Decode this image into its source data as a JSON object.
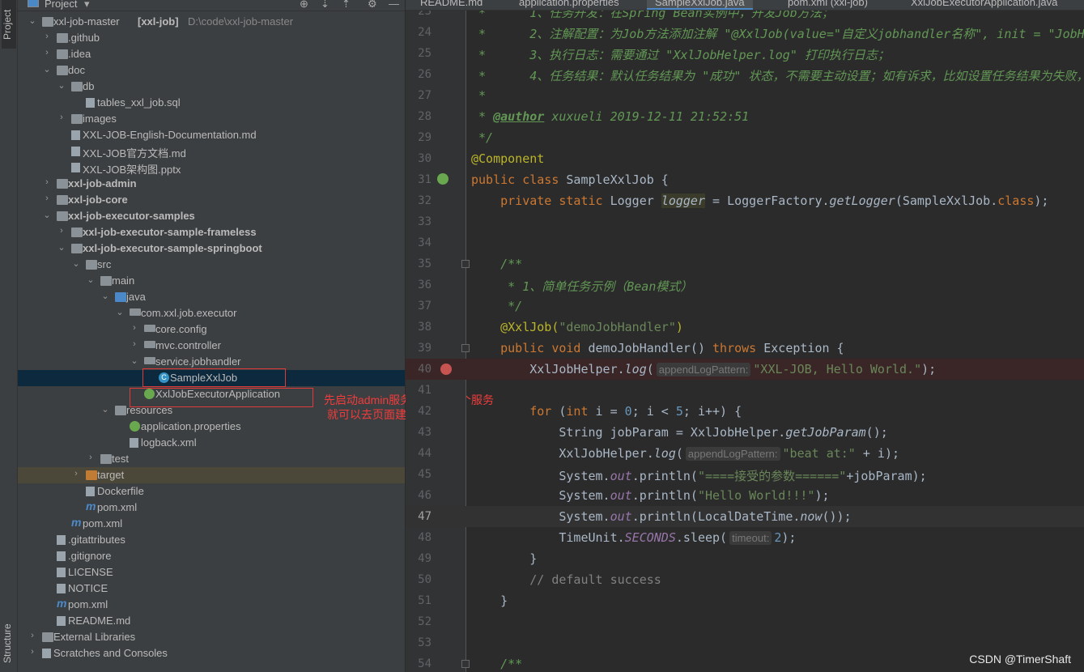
{
  "sidebar": {
    "project_tab": "Project",
    "structure_tab": "Structure"
  },
  "project_panel": {
    "title": "Project",
    "header_icons": [
      "locate-icon",
      "expand-all-icon",
      "collapse-all-icon",
      "gear-icon",
      "minimize-icon"
    ],
    "tree": [
      {
        "label": "xxl-job-master",
        "suffix": "[xxl-job]",
        "hint": "D:\\code\\xxl-job-master",
        "depth": 0,
        "arrow": "open",
        "icon": "module"
      },
      {
        "label": ".github",
        "depth": 1,
        "arrow": "closed",
        "icon": "folder"
      },
      {
        "label": ".idea",
        "depth": 1,
        "arrow": "closed",
        "icon": "folder"
      },
      {
        "label": "doc",
        "depth": 1,
        "arrow": "open",
        "icon": "folder"
      },
      {
        "label": "db",
        "depth": 2,
        "arrow": "open",
        "icon": "folder"
      },
      {
        "label": "tables_xxl_job.sql",
        "depth": 3,
        "icon": "sql"
      },
      {
        "label": "images",
        "depth": 2,
        "arrow": "closed",
        "icon": "folder"
      },
      {
        "label": "XXL-JOB-English-Documentation.md",
        "depth": 2,
        "icon": "md"
      },
      {
        "label": "XXL-JOB官方文档.md",
        "depth": 2,
        "icon": "md"
      },
      {
        "label": "XXL-JOB架构图.pptx",
        "depth": 2,
        "icon": "file"
      },
      {
        "label": "xxl-job-admin",
        "depth": 1,
        "arrow": "closed",
        "icon": "folder",
        "bold": true
      },
      {
        "label": "xxl-job-core",
        "depth": 1,
        "arrow": "closed",
        "icon": "folder",
        "bold": true
      },
      {
        "label": "xxl-job-executor-samples",
        "depth": 1,
        "arrow": "open",
        "icon": "folder",
        "bold": true
      },
      {
        "label": "xxl-job-executor-sample-frameless",
        "depth": 2,
        "arrow": "closed",
        "icon": "folder",
        "bold": true
      },
      {
        "label": "xxl-job-executor-sample-springboot",
        "depth": 2,
        "arrow": "open",
        "icon": "folder",
        "bold": true
      },
      {
        "label": "src",
        "depth": 3,
        "arrow": "open",
        "icon": "folder"
      },
      {
        "label": "main",
        "depth": 4,
        "arrow": "open",
        "icon": "folder"
      },
      {
        "label": "java",
        "depth": 5,
        "arrow": "open",
        "icon": "folder-blue"
      },
      {
        "label": "com.xxl.job.executor",
        "depth": 6,
        "arrow": "open",
        "icon": "package"
      },
      {
        "label": "core.config",
        "depth": 7,
        "arrow": "closed",
        "icon": "package"
      },
      {
        "label": "mvc.controller",
        "depth": 7,
        "arrow": "closed",
        "icon": "package"
      },
      {
        "label": "service.jobhandler",
        "depth": 7,
        "arrow": "open",
        "icon": "package"
      },
      {
        "label": "SampleXxlJob",
        "depth": 8,
        "icon": "class",
        "selected": true
      },
      {
        "label": "XxlJobExecutorApplication",
        "depth": 7,
        "icon": "spring-class"
      },
      {
        "label": "resources",
        "depth": 5,
        "arrow": "open",
        "icon": "folder"
      },
      {
        "label": "application.properties",
        "depth": 6,
        "icon": "spring-props"
      },
      {
        "label": "logback.xml",
        "depth": 6,
        "icon": "xml"
      },
      {
        "label": "test",
        "depth": 4,
        "arrow": "closed",
        "icon": "folder"
      },
      {
        "label": "target",
        "depth": 3,
        "arrow": "closed",
        "icon": "folder-orange",
        "highlight": true
      },
      {
        "label": "Dockerfile",
        "depth": 3,
        "icon": "file"
      },
      {
        "label": "pom.xml",
        "depth": 3,
        "icon": "maven"
      },
      {
        "label": "pom.xml",
        "depth": 2,
        "icon": "maven"
      },
      {
        "label": ".gitattributes",
        "depth": 1,
        "icon": "file"
      },
      {
        "label": ".gitignore",
        "depth": 1,
        "icon": "file"
      },
      {
        "label": "LICENSE",
        "depth": 1,
        "icon": "file"
      },
      {
        "label": "NOTICE",
        "depth": 1,
        "icon": "file"
      },
      {
        "label": "pom.xml",
        "depth": 1,
        "icon": "maven"
      },
      {
        "label": "README.md",
        "depth": 1,
        "icon": "md"
      },
      {
        "label": "External Libraries",
        "depth": 0,
        "arrow": "closed",
        "icon": "library"
      },
      {
        "label": "Scratches and Consoles",
        "depth": 0,
        "arrow": "closed",
        "icon": "scratch"
      }
    ]
  },
  "annotation": {
    "line1": "先启动admin服务 再启动这个服务",
    "line2": "就可以去页面建定时任务了",
    "color": "#f03c3c"
  },
  "tabs": [
    {
      "label": "README.md",
      "icon": "md"
    },
    {
      "label": "application.properties",
      "icon": "spring-props"
    },
    {
      "label": "SampleXxlJob.java",
      "icon": "class",
      "active": true
    },
    {
      "label": "pom.xml (xxl-job)",
      "icon": "maven"
    },
    {
      "label": "XxlJobExecutorApplication.java",
      "icon": "spring-class"
    }
  ],
  "editor": {
    "first_line": 23,
    "breakpoint_line": 40,
    "current_line": 47,
    "lines": [
      [
        [
          " *      1、任务开发：在Spring Bean实例中，开发Job方法；",
          "c"
        ]
      ],
      [
        [
          " *      2、注解配置：为Job方法添加注解 \"@XxlJob(value=\"自定义jobhandler名称\", init = \"JobH",
          "c"
        ]
      ],
      [
        [
          " *      3、执行日志：需要通过 \"XxlJobHelper.log\" 打印执行日志；",
          "c"
        ]
      ],
      [
        [
          " *      4、任务结果：默认任务结果为 \"成功\" 状态，不需要主动设置；如有诉求，比如设置任务结果为失败，",
          "c"
        ]
      ],
      [
        [
          " *",
          "c"
        ]
      ],
      [
        [
          " * ",
          "c"
        ],
        [
          "@author",
          "tag"
        ],
        [
          " xuxueli 2019-12-11 21:52:51",
          "c"
        ]
      ],
      [
        [
          " */",
          "c"
        ]
      ],
      [
        [
          "@Component",
          "a"
        ]
      ],
      [
        [
          "public class ",
          "k"
        ],
        [
          "SampleXxlJob {",
          "t"
        ]
      ],
      [
        [
          "    private static ",
          "k"
        ],
        [
          "Logger ",
          "t"
        ],
        [
          "logger",
          "fv"
        ],
        [
          " = LoggerFactory.",
          "t"
        ],
        [
          "getLogger",
          "m"
        ],
        [
          "(SampleXxlJob.",
          "t"
        ],
        [
          "class",
          "k"
        ],
        [
          ");",
          "t"
        ]
      ],
      [],
      [],
      [
        [
          "    /**",
          "c"
        ]
      ],
      [
        [
          "     * 1、简单任务示例（Bean模式）",
          "c"
        ]
      ],
      [
        [
          "     */",
          "c"
        ]
      ],
      [
        [
          "    @XxlJob(",
          "a"
        ],
        [
          "\"demoJobHandler\"",
          "s"
        ],
        [
          ")",
          "a"
        ]
      ],
      [
        [
          "    public void ",
          "k"
        ],
        [
          "demoJobHandler() ",
          "t"
        ],
        [
          "throws ",
          "k"
        ],
        [
          "Exception {",
          "t"
        ]
      ],
      [
        [
          "        XxlJobHelper.",
          "t"
        ],
        [
          "log",
          "m"
        ],
        [
          "(",
          "t"
        ],
        [
          "appendLogPattern:",
          "h"
        ],
        [
          "\"XXL-JOB, Hello World.\"",
          "s"
        ],
        [
          ");",
          "t"
        ]
      ],
      [],
      [
        [
          "        for ",
          "k"
        ],
        [
          "(",
          "t"
        ],
        [
          "int ",
          "k"
        ],
        [
          "i = ",
          "t"
        ],
        [
          "0",
          "n"
        ],
        [
          "; i < ",
          "t"
        ],
        [
          "5",
          "n"
        ],
        [
          "; i++) {",
          "t"
        ]
      ],
      [
        [
          "            String jobParam = XxlJobHelper.",
          "t"
        ],
        [
          "getJobParam",
          "m"
        ],
        [
          "();",
          "t"
        ]
      ],
      [
        [
          "            XxlJobHelper.",
          "t"
        ],
        [
          "log",
          "m"
        ],
        [
          "(",
          "t"
        ],
        [
          "appendLogPattern:",
          "h"
        ],
        [
          "\"beat at:\"",
          "s"
        ],
        [
          " + i);",
          "t"
        ]
      ],
      [
        [
          "            System.",
          "t"
        ],
        [
          "out",
          "f"
        ],
        [
          ".println(",
          "t"
        ],
        [
          "\"====接受的参数======\"",
          "s"
        ],
        [
          "+jobParam);",
          "t"
        ]
      ],
      [
        [
          "            System.",
          "t"
        ],
        [
          "out",
          "f"
        ],
        [
          ".println(",
          "t"
        ],
        [
          "\"Hello World!!!\"",
          "s"
        ],
        [
          ");",
          "t"
        ]
      ],
      [
        [
          "            System.",
          "t"
        ],
        [
          "out",
          "f"
        ],
        [
          ".println(LocalDateTime.",
          "t"
        ],
        [
          "now",
          "m"
        ],
        [
          "());",
          "t"
        ]
      ],
      [
        [
          "            TimeUnit.",
          "t"
        ],
        [
          "SECONDS",
          "f"
        ],
        [
          ".sleep(",
          "t"
        ],
        [
          "timeout:",
          "h"
        ],
        [
          "2",
          "n"
        ],
        [
          ");",
          "t"
        ]
      ],
      [
        [
          "        }",
          "t"
        ]
      ],
      [
        [
          "        // default success",
          "d"
        ]
      ],
      [
        [
          "    }",
          "t"
        ]
      ],
      [],
      [],
      [
        [
          "    /**",
          "c"
        ]
      ]
    ]
  },
  "watermark": "CSDN @TimerShaft"
}
